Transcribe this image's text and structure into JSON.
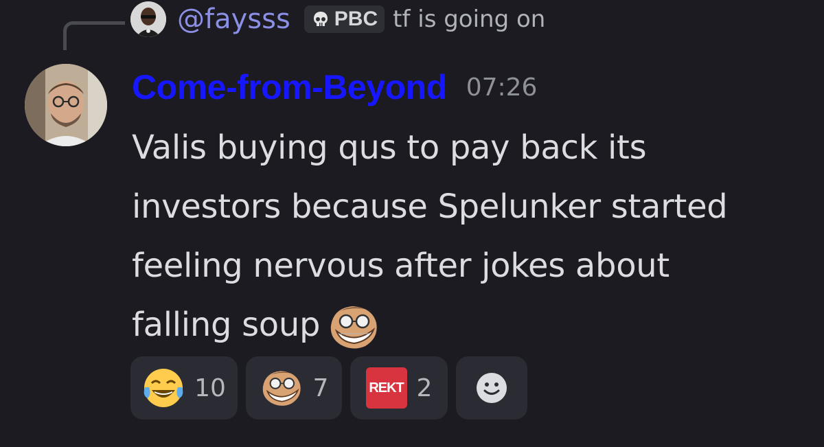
{
  "reply": {
    "username": "@faysss",
    "tag": "PBC",
    "text": "tf is going on"
  },
  "message": {
    "author": "Come-from-Beyond",
    "time": "07:26",
    "lines": [
      "Valis buying qus to pay back its",
      "investors because Spelunker started",
      "feeling nervous after jokes about",
      "falling soup"
    ]
  },
  "reactions": [
    {
      "emoji": "joy-emoji",
      "count": "10"
    },
    {
      "emoji": "troll-glasses-emoji",
      "count": "7"
    },
    {
      "emoji": "rekt-emoji",
      "label": "REKT",
      "count": "2"
    }
  ],
  "colors": {
    "background": "#1b1b21",
    "author": "#1717ff",
    "reply_name": "#8c8fe6",
    "rekt": "#d8343f"
  }
}
